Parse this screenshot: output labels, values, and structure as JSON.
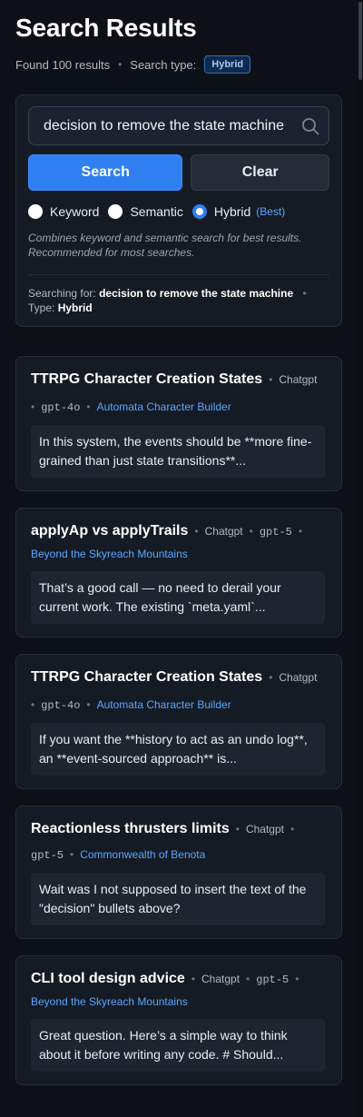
{
  "page": {
    "title": "Search Results",
    "found": "Found 100 results",
    "search_type_label": "Search type:",
    "search_type_badge": "Hybrid"
  },
  "search": {
    "value": "decision to remove the state machine",
    "search_icon": "search-icon",
    "search_button": "Search",
    "clear_button": "Clear",
    "options": [
      {
        "label": "Keyword",
        "selected": false
      },
      {
        "label": "Semantic",
        "selected": false
      },
      {
        "label": "Hybrid",
        "selected": true
      }
    ],
    "best_label": "(Best)",
    "hint_line1": "Combines keyword and semantic search for best results.",
    "hint_line2": "Recommended for most searches.",
    "searching_for_label": "Searching for:",
    "searching_for_value": "decision to remove the state machine",
    "type_label": "Type:",
    "type_value": "Hybrid"
  },
  "results": [
    {
      "title": "TTRPG Character Creation States",
      "source": "Chatgpt",
      "model": "gpt-4o",
      "project": "Automata Character Builder",
      "snippet": "In this system, the events should be **more fine-grained than just state transitions**..."
    },
    {
      "title": "applyAp vs applyTrails",
      "source": "Chatgpt",
      "model": "gpt-5",
      "project": "Beyond the Skyreach Mountains",
      "snippet": "That’s a good call — no need to derail your current work. The existing `meta.yaml`..."
    },
    {
      "title": "TTRPG Character Creation States",
      "source": "Chatgpt",
      "model": "gpt-4o",
      "project": "Automata Character Builder",
      "snippet": "If you want the **history to act as an undo log**, an **event-sourced approach** is..."
    },
    {
      "title": "Reactionless thrusters limits",
      "source": "Chatgpt",
      "model": "gpt-5",
      "project": "Commonwealth of Benota",
      "snippet": "Wait was I not supposed to insert the text of the \"decision\" bullets above?"
    },
    {
      "title": "CLI tool design advice",
      "source": "Chatgpt",
      "model": "gpt-5",
      "project": "Beyond the Skyreach Mountains",
      "snippet": "Great question. Here’s a simple way to think about it before writing any code. # Should..."
    }
  ],
  "colors": {
    "background": "#0d1117",
    "panel": "#151b24",
    "accent": "#2f7ff0",
    "link": "#58a6ff"
  }
}
